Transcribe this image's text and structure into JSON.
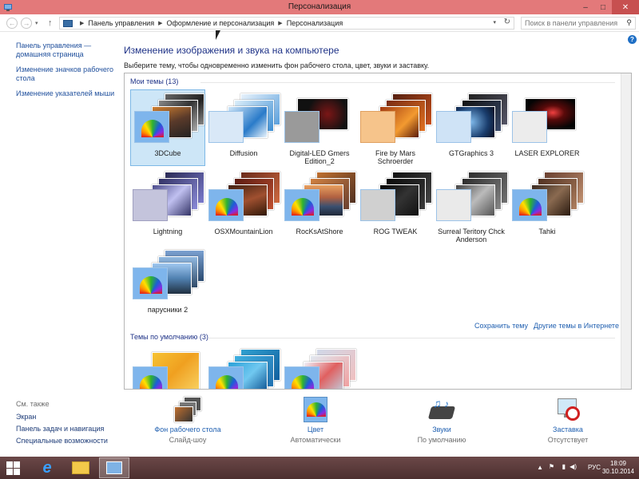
{
  "window": {
    "title": "Персонализация",
    "controls": {
      "minimize": "–",
      "maximize": "□",
      "close": "✕"
    }
  },
  "address": {
    "crumbs": [
      "Панель управления",
      "Оформление и персонализация",
      "Персонализация"
    ],
    "search_placeholder": "Поиск в панели управления"
  },
  "left_nav": {
    "items": [
      "Панель управления — домашняя страница",
      "Изменение значков рабочего стола",
      "Изменение указателей мыши"
    ]
  },
  "see_also": {
    "heading": "См. также",
    "items": [
      "Экран",
      "Панель задач и навигация",
      "Специальные возможности"
    ]
  },
  "main": {
    "title": "Изменение изображения и звука на компьютере",
    "subtitle": "Выберите тему, чтобы одновременно изменить фон рабочего стола, цвет, звуки и заставку."
  },
  "my_themes": {
    "heading": "Мои темы (13)",
    "themes": [
      {
        "name": "3DCube",
        "selected": true
      },
      {
        "name": "Diffusion"
      },
      {
        "name": "Digital-LED Gmers Edition_2"
      },
      {
        "name": "Fire by Mars Schroerder"
      },
      {
        "name": "GTGraphics 3"
      },
      {
        "name": "LASER EXPLORER"
      },
      {
        "name": "Lightning"
      },
      {
        "name": "OSXMountainLion"
      },
      {
        "name": "RocKsAtShore"
      },
      {
        "name": "ROG TWEAK"
      },
      {
        "name": "Surreal Teritory Chck Anderson"
      },
      {
        "name": "Tahki"
      },
      {
        "name": "парусники 2"
      }
    ],
    "save_link": "Сохранить тему",
    "more_link": "Другие темы в Интернете"
  },
  "default_themes": {
    "heading": "Темы по умолчанию (3)"
  },
  "bottom": {
    "background": {
      "title": "Фон рабочего стола",
      "sub": "Слайд-шоу"
    },
    "color": {
      "title": "Цвет",
      "sub": "Автоматически"
    },
    "sounds": {
      "title": "Звуки",
      "sub": "По умолчанию"
    },
    "screensaver": {
      "title": "Заставка",
      "sub": "Отсутствует"
    }
  },
  "taskbar": {
    "lang": "РУС",
    "time": "18:09",
    "date": "30.10.2014"
  },
  "colors": {
    "titlebar": "#e3797a",
    "link": "#1f5fb0",
    "heading": "#1e3287",
    "taskbar": "#5b3a3a"
  }
}
